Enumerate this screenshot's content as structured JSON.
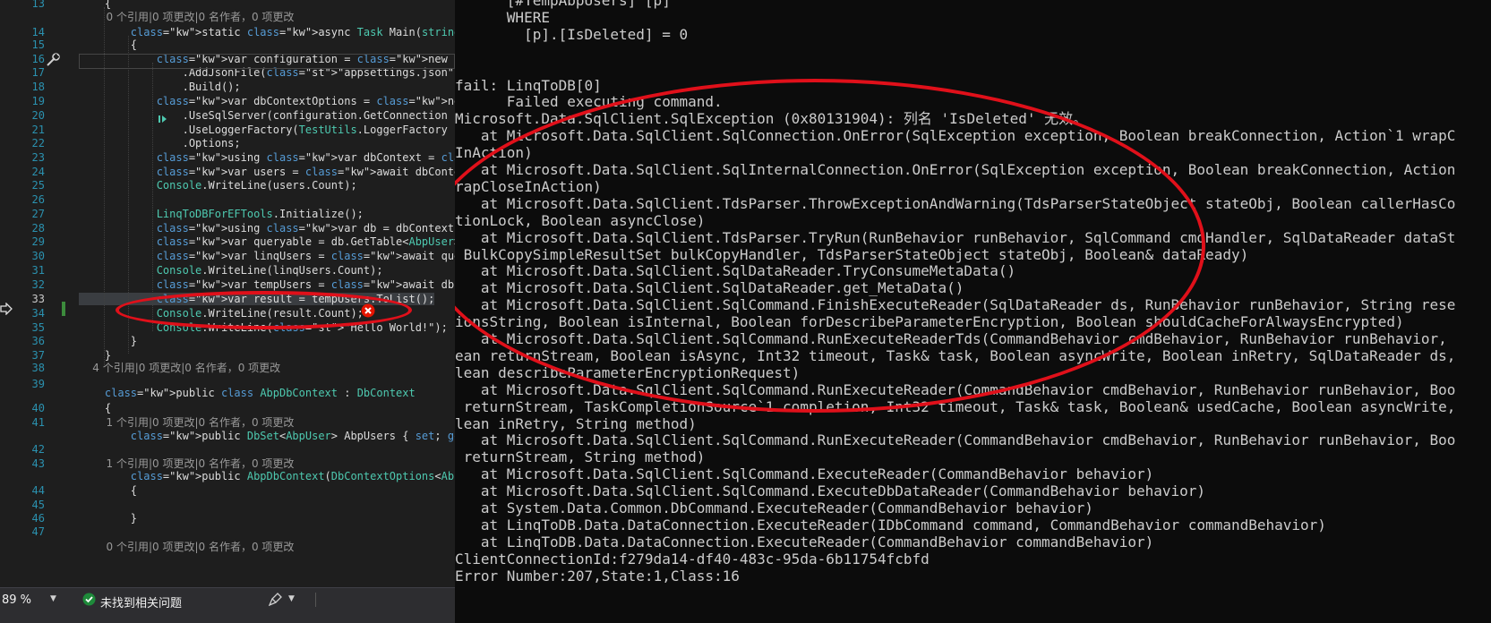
{
  "editor": {
    "line_numbers": [
      "13",
      "14",
      "15",
      "16",
      "17",
      "18",
      "19",
      "20",
      "21",
      "22",
      "23",
      "24",
      "25",
      "26",
      "27",
      "28",
      "29",
      "30",
      "31",
      "32",
      "33",
      "34",
      "35",
      "36",
      "37",
      "38",
      "39",
      "40",
      "41",
      "42",
      "43",
      "44",
      "45",
      "46",
      "47"
    ],
    "lines": [
      "    {",
      "        0 个引用|0 项更改|0 名作者，0 项更改",
      "        static async Task Main(string[] args)",
      "        {",
      "            var configuration = new ConfigurationBuilder()",
      "                .AddJsonFile(\"appsettings.json\", optional",
      "                .Build();",
      "            var dbContextOptions = new DbContextOptionsBu",
      "                .UseSqlServer(configuration.GetConnection",
      "                .UseLoggerFactory(TestUtils.LoggerFactory",
      "                .Options;",
      "            using var dbContext = new AbpDbContext(dbConte",
      "            var users = await dbContext.AbpUsers.OrderBy(",
      "            Console.WriteLine(users.Count);",
      "",
      "            LinqToDBForEFTools.Initialize();",
      "            using var db = dbContext.CreateLinqToDbContext",
      "            var queryable = db.GetTable<AbpUser>().OrderB",
      "            var linqUsers = await queryable.ToListAsyncLi",
      "            Console.WriteLine(linqUsers.Count);",
      "            var tempUsers = await db.CreateTempTableAsync",
      "            var result = tempUsers.ToList();",
      "            Console.WriteLine(result.Count);",
      "            Console.WriteLine(\"Hello World!\");",
      "        }",
      "    }",
      "    4 个引用|0 项更改|0 名作者，0 项更改",
      "    public class AbpDbContext : DbContext",
      "    {",
      "        1 个引用|0 项更改|0 名作者，0 项更改",
      "        public DbSet<AbpUser> AbpUsers { set; get; }",
      "",
      "        1 个引用|0 项更改|0 名作者，0 项更改",
      "        public AbpDbContext(DbContextOptions<AbpDbContext>",
      "        {",
      "",
      "        }",
      "",
      "        0 个引用|0 项更改|0 名作者，0 项更改"
    ],
    "status": {
      "zoom": "89 %",
      "issues": "未找到相关问题"
    },
    "colors": {
      "background": "#1e1e1e",
      "error_icon": "#e51400",
      "highlight_ellipse": "#e0101a"
    }
  },
  "console": {
    "lines": [
      "      [#TempAbpUsers] [p]",
      "      WHERE",
      "        [p].[IsDeleted] = 0",
      "",
      "",
      "fail: LinqToDB[0]",
      "      Failed executing command.",
      "Microsoft.Data.SqlClient.SqlException (0x80131904): 列名 'IsDeleted' 无效。",
      "   at Microsoft.Data.SqlClient.SqlConnection.OnError(SqlException exception, Boolean breakConnection, Action`1 wrapC",
      "InAction)",
      "   at Microsoft.Data.SqlClient.SqlInternalConnection.OnError(SqlException exception, Boolean breakConnection, Action",
      "rapCloseInAction)",
      "   at Microsoft.Data.SqlClient.TdsParser.ThrowExceptionAndWarning(TdsParserStateObject stateObj, Boolean callerHasCo",
      "tionLock, Boolean asyncClose)",
      "   at Microsoft.Data.SqlClient.TdsParser.TryRun(RunBehavior runBehavior, SqlCommand cmdHandler, SqlDataReader dataSt",
      " BulkCopySimpleResultSet bulkCopyHandler, TdsParserStateObject stateObj, Boolean& dataReady)",
      "   at Microsoft.Data.SqlClient.SqlDataReader.TryConsumeMetaData()",
      "   at Microsoft.Data.SqlClient.SqlDataReader.get_MetaData()",
      "   at Microsoft.Data.SqlClient.SqlCommand.FinishExecuteReader(SqlDataReader ds, RunBehavior runBehavior, String rese",
      "ionsString, Boolean isInternal, Boolean forDescribeParameterEncryption, Boolean shouldCacheForAlwaysEncrypted)",
      "   at Microsoft.Data.SqlClient.SqlCommand.RunExecuteReaderTds(CommandBehavior cmdBehavior, RunBehavior runBehavior,",
      "ean returnStream, Boolean isAsync, Int32 timeout, Task& task, Boolean asyncWrite, Boolean inRetry, SqlDataReader ds,",
      "lean describeParameterEncryptionRequest)",
      "   at Microsoft.Data.SqlClient.SqlCommand.RunExecuteReader(CommandBehavior cmdBehavior, RunBehavior runBehavior, Boo",
      " returnStream, TaskCompletionSource`1 completion, Int32 timeout, Task& task, Boolean& usedCache, Boolean asyncWrite,",
      "lean inRetry, String method)",
      "   at Microsoft.Data.SqlClient.SqlCommand.RunExecuteReader(CommandBehavior cmdBehavior, RunBehavior runBehavior, Boo",
      " returnStream, String method)",
      "   at Microsoft.Data.SqlClient.SqlCommand.ExecuteReader(CommandBehavior behavior)",
      "   at Microsoft.Data.SqlClient.SqlCommand.ExecuteDbDataReader(CommandBehavior behavior)",
      "   at System.Data.Common.DbCommand.ExecuteReader(CommandBehavior behavior)",
      "   at LinqToDB.Data.DataConnection.ExecuteReader(IDbCommand command, CommandBehavior commandBehavior)",
      "   at LinqToDB.Data.DataConnection.ExecuteReader(CommandBehavior commandBehavior)",
      "ClientConnectionId:f279da14-df40-483c-95da-6b11754fcbfd",
      "Error Number:207,State:1,Class:16"
    ],
    "colors": {
      "background": "#0c0c0c",
      "text": "#cccccc"
    }
  }
}
